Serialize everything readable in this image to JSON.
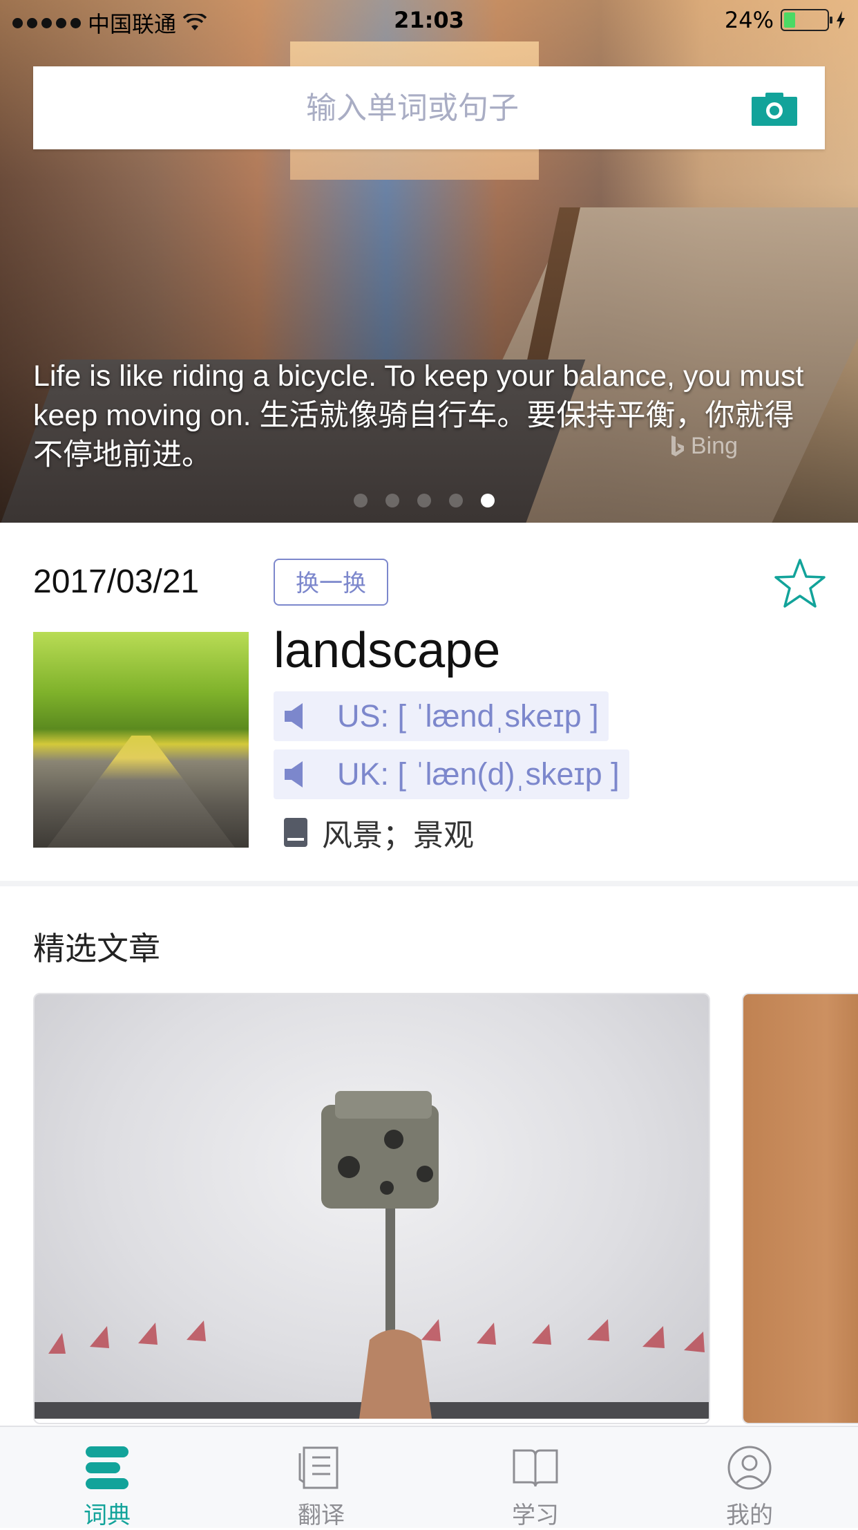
{
  "status_bar": {
    "carrier": "中国联通",
    "time": "21:03",
    "battery": "24%"
  },
  "search": {
    "placeholder": "输入单词或句子",
    "camera_icon": "camera-icon"
  },
  "banner": {
    "quote": "Life is like riding a bicycle. To keep your balance, you must keep moving on. 生活就像骑自行车。要保持平衡，你就得不停地前进。",
    "source": "Bing",
    "page_count": 5,
    "active_page": 5
  },
  "word_of_day": {
    "date": "2017/03/21",
    "change_label": "换一换",
    "word": "landscape",
    "us_pron": "US: [ ˈlændˌskeɪp ]",
    "uk_pron": "UK: [ ˈlæn(d)ˌskeɪp ]",
    "meaning": "风景；景观",
    "favorited": false
  },
  "articles": {
    "title": "精选文章"
  },
  "tabs": [
    {
      "label": "词典",
      "icon": "dictionary-icon",
      "active": true
    },
    {
      "label": "翻译",
      "icon": "translate-icon",
      "active": false
    },
    {
      "label": "学习",
      "icon": "book-icon",
      "active": false
    },
    {
      "label": "我的",
      "icon": "profile-icon",
      "active": false
    }
  ],
  "colors": {
    "accent": "#12a39a",
    "link": "#7c87cc",
    "pron_bg": "#eef0fb"
  }
}
